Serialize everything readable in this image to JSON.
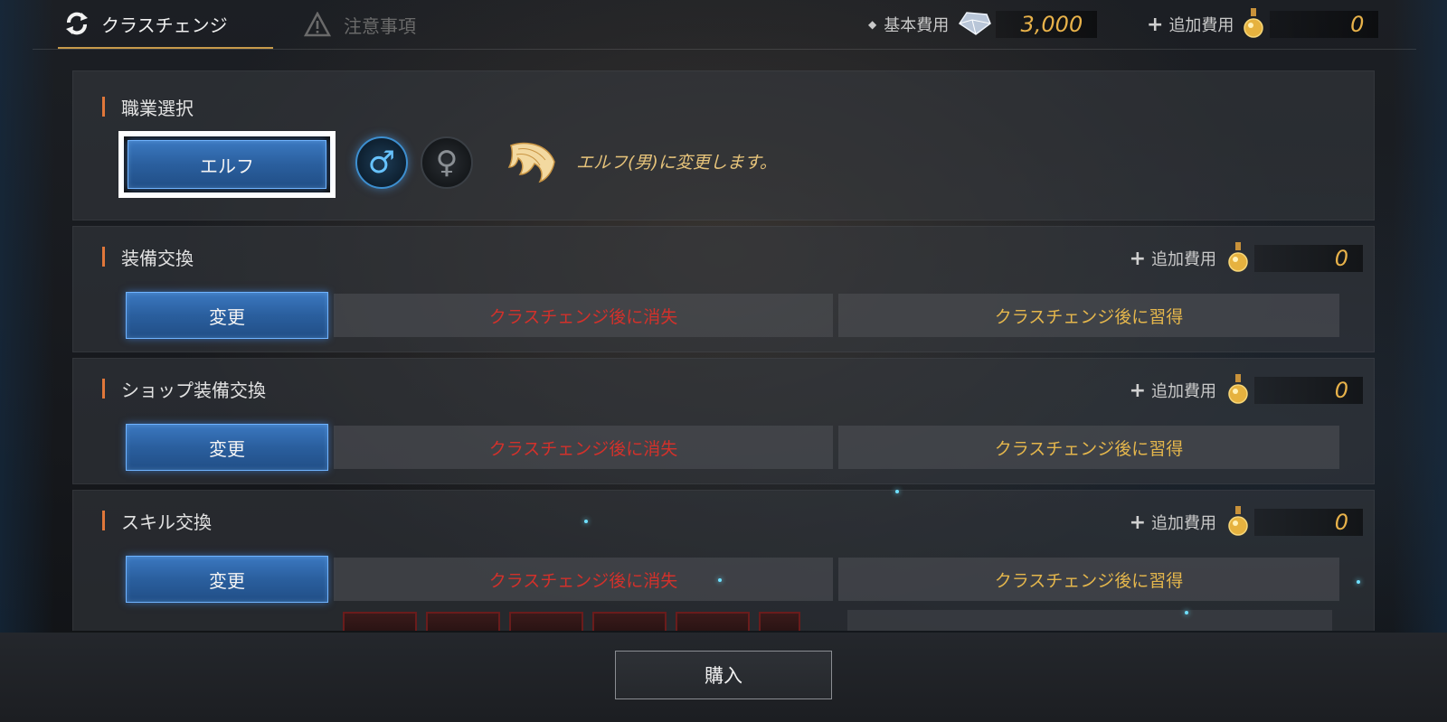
{
  "tabs": {
    "class_change": "クラスチェンジ",
    "notes": "注意事項"
  },
  "costs": {
    "base_label": "基本費用",
    "base_value": "3,000",
    "extra_label": "追加費用",
    "extra_value": "0"
  },
  "sections": {
    "class_select": {
      "title": "職業選択",
      "class_button": "エルフ",
      "male_symbol": "♂",
      "female_symbol": "♀",
      "message": "エルフ(男)に変更します。"
    },
    "equipment": {
      "title": "装備交換",
      "extra_label": "追加費用",
      "extra_value": "0",
      "change_button": "変更",
      "lose_text": "クラスチェンジ後に消失",
      "gain_text": "クラスチェンジ後に習得"
    },
    "shop_equipment": {
      "title": "ショップ装備交換",
      "extra_label": "追加費用",
      "extra_value": "0",
      "change_button": "変更",
      "lose_text": "クラスチェンジ後に消失",
      "gain_text": "クラスチェンジ後に習得"
    },
    "skill": {
      "title": "スキル交換",
      "extra_label": "追加費用",
      "extra_value": "0",
      "change_button": "変更",
      "lose_text": "クラスチェンジ後に消失",
      "gain_text": "クラスチェンジ後に習得"
    }
  },
  "footer": {
    "buy_button": "購入"
  },
  "colors": {
    "accent_gold": "#e8b24a",
    "lose_red": "#d2312b",
    "button_blue": "#2a5f9e"
  },
  "icons": [
    "refresh-icon",
    "warning-icon",
    "diamond-icon",
    "potion-icon",
    "male-icon",
    "female-icon",
    "wing-icon"
  ]
}
